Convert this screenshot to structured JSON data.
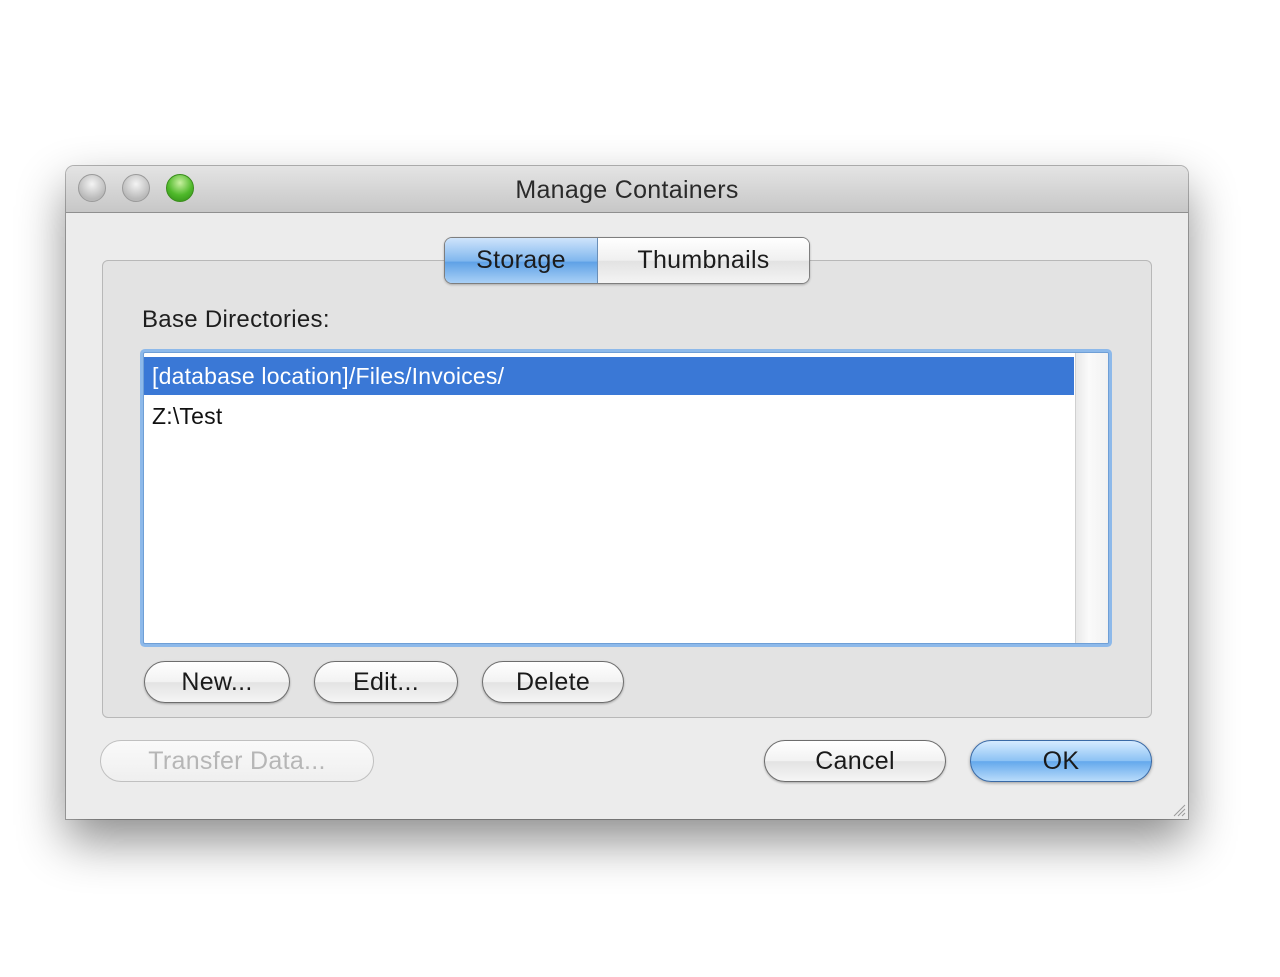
{
  "window": {
    "title": "Manage Containers"
  },
  "tabs": [
    {
      "label": "Storage",
      "selected": true
    },
    {
      "label": "Thumbnails",
      "selected": false
    }
  ],
  "storage": {
    "section_label": "Base Directories:",
    "directories": [
      {
        "path": "[database location]/Files/Invoices/",
        "selected": true
      },
      {
        "path": "Z:\\Test",
        "selected": false
      }
    ],
    "buttons": {
      "new_label": "New...",
      "edit_label": "Edit...",
      "delete_label": "Delete"
    }
  },
  "footer": {
    "transfer_label": "Transfer Data...",
    "transfer_enabled": false,
    "cancel_label": "Cancel",
    "ok_label": "OK"
  },
  "colors": {
    "selection": "#3a78d6",
    "focus_ring": "#8db9ea",
    "default_button": "#63a8ec",
    "window_bg": "#ececec"
  },
  "icons": {
    "close": "close-icon",
    "minimize": "minimize-icon",
    "zoom": "zoom-icon",
    "resize": "resize-grip-icon"
  }
}
